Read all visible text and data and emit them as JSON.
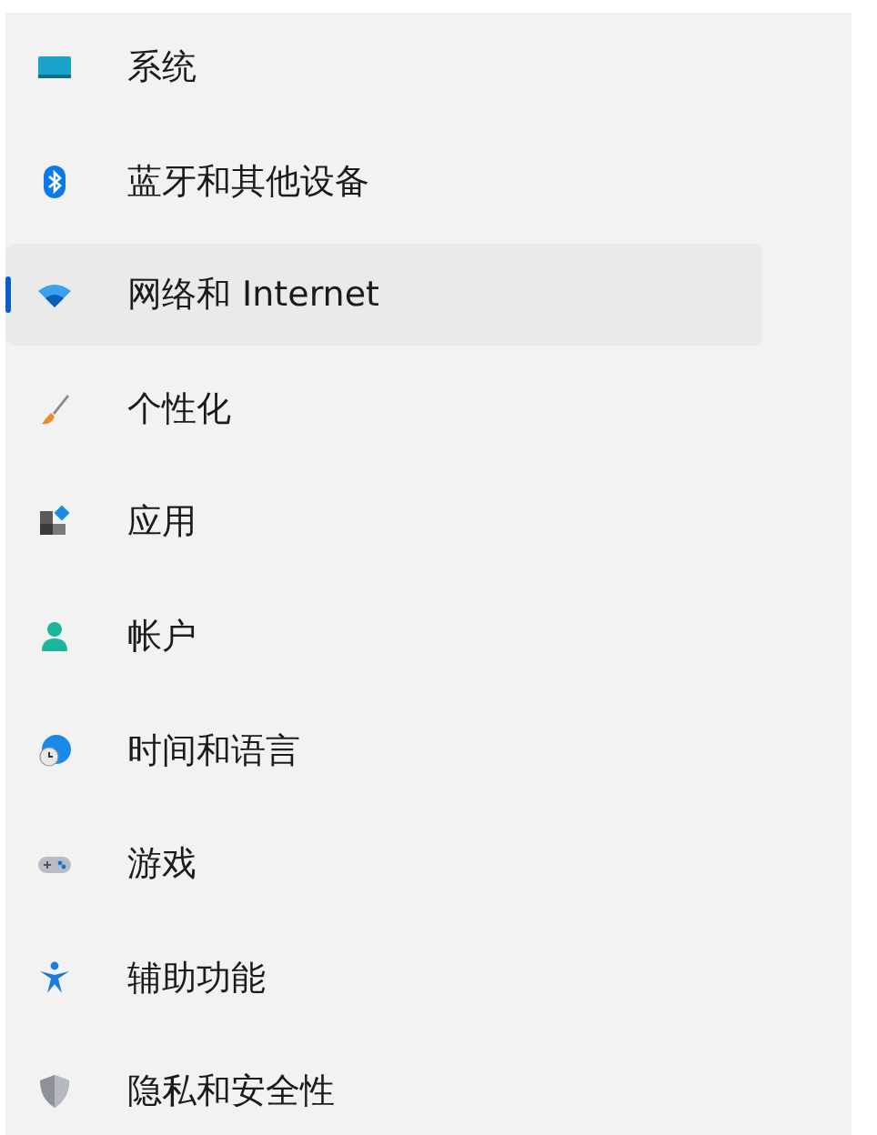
{
  "sidebar": {
    "items": [
      {
        "label": "系统",
        "kind": "system",
        "selected": false
      },
      {
        "label": "蓝牙和其他设备",
        "kind": "bluetooth",
        "selected": false
      },
      {
        "label": "网络和 Internet",
        "kind": "network",
        "selected": true
      },
      {
        "label": "个性化",
        "kind": "brush",
        "selected": false
      },
      {
        "label": "应用",
        "kind": "apps",
        "selected": false
      },
      {
        "label": "帐户",
        "kind": "account",
        "selected": false
      },
      {
        "label": "时间和语言",
        "kind": "time",
        "selected": false
      },
      {
        "label": "游戏",
        "kind": "gaming",
        "selected": false
      },
      {
        "label": "辅助功能",
        "kind": "accessibility",
        "selected": false
      },
      {
        "label": "隐私和安全性",
        "kind": "privacy",
        "selected": false
      }
    ]
  }
}
